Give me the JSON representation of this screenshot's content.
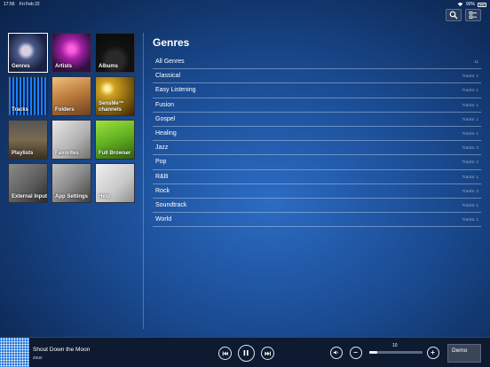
{
  "status": {
    "time": "17:56",
    "date": "Fri Feb 22",
    "battery": "90%"
  },
  "tiles": [
    {
      "label": "Genres",
      "icon": "genres-icon",
      "selected": true
    },
    {
      "label": "Artists",
      "icon": "artists-icon"
    },
    {
      "label": "Albums",
      "icon": "albums-icon"
    },
    {
      "label": "Tracks",
      "icon": "tracks-icon"
    },
    {
      "label": "Folders",
      "icon": "folders-icon"
    },
    {
      "label": "SensMe™ channels",
      "icon": "sensme-icon"
    },
    {
      "label": "Playlists",
      "icon": "playlists-icon"
    },
    {
      "label": "Favorites",
      "icon": "favorites-icon"
    },
    {
      "label": "Full Browser",
      "icon": "full-browser-icon"
    },
    {
      "label": "External Input",
      "icon": "external-input-icon"
    },
    {
      "label": "App Settings",
      "icon": "app-settings-icon"
    },
    {
      "label": "Help",
      "icon": "help-icon"
    }
  ],
  "panel": {
    "title": "Genres",
    "rows": [
      {
        "name": "All Genres",
        "count": "11"
      },
      {
        "name": "Classical",
        "count": "Tracks: 1"
      },
      {
        "name": "Easy Listening",
        "count": "Tracks: 1"
      },
      {
        "name": "Fusion",
        "count": "Tracks: 1"
      },
      {
        "name": "Gospel",
        "count": "Tracks: 1"
      },
      {
        "name": "Healing",
        "count": "Tracks: 1"
      },
      {
        "name": "Jazz",
        "count": "Tracks: 3"
      },
      {
        "name": "Pop",
        "count": "Tracks: 2"
      },
      {
        "name": "R&B",
        "count": "Tracks: 1"
      },
      {
        "name": "Rock",
        "count": "Tracks: 2"
      },
      {
        "name": "Soundtrack",
        "count": "Tracks: 1"
      },
      {
        "name": "World",
        "count": "Tracks: 1"
      }
    ]
  },
  "player": {
    "title": "Shout Down the Moon",
    "artist": "zoux",
    "volume": "10",
    "volume_fraction": 0.15,
    "device": "Demo"
  }
}
